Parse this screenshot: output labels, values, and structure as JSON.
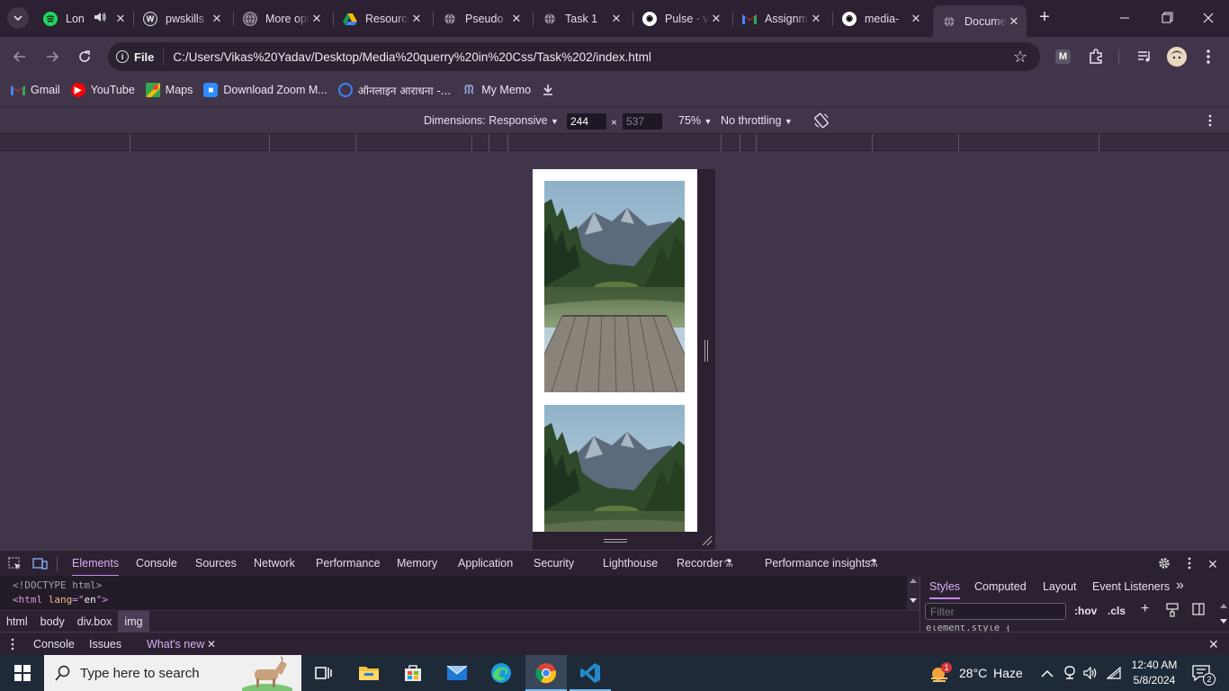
{
  "tabs": [
    {
      "label": "Lon",
      "icon": "spotify-icon",
      "audio": true
    },
    {
      "label": "pwskills",
      "icon": "wordpress-icon"
    },
    {
      "label": "More options",
      "icon": "globe-icon"
    },
    {
      "label": "Resources",
      "icon": "google-drive-icon"
    },
    {
      "label": "Pseudo",
      "icon": "globe-icon"
    },
    {
      "label": "Task 1",
      "icon": "globe-icon"
    },
    {
      "label": "Pulse · v",
      "icon": "github-icon"
    },
    {
      "label": "Assignment",
      "icon": "gmail-icon"
    },
    {
      "label": "media-",
      "icon": "github-icon"
    },
    {
      "label": "Document",
      "icon": "globe-icon",
      "active": true
    }
  ],
  "toolbar": {
    "file_chip": "File",
    "url": "C:/Users/Vikas%20Yadav/Desktop/Media%20querry%20in%20Css/Task%202/index.html"
  },
  "bookmarks": [
    {
      "label": "Gmail",
      "icon": "gmail-icon"
    },
    {
      "label": "YouTube",
      "icon": "youtube-icon"
    },
    {
      "label": "Maps",
      "icon": "maps-icon"
    },
    {
      "label": "Download Zoom M...",
      "icon": "zoom-icon"
    },
    {
      "label": "ऑनलाइन आराधना -...",
      "icon": "aradhana-icon"
    },
    {
      "label": "My Memo",
      "icon": "memo-icon"
    }
  ],
  "device": {
    "dimensions": "Dimensions: Responsive",
    "width": "244",
    "times": "×",
    "height": "537",
    "zoom": "75%",
    "throttle": "No throttling"
  },
  "devtools": {
    "tabs": [
      "Elements",
      "Console",
      "Sources",
      "Network",
      "Performance",
      "Memory",
      "Application",
      "Security",
      "Lighthouse",
      "Recorder",
      "Performance insights"
    ],
    "code_line1": "<!DOCTYPE html>",
    "code_line2_open": "<html ",
    "code_line2_attr": "lang",
    "code_line2_eq": "=\"",
    "code_line2_val": "en",
    "code_line2_close": "\">",
    "breadcrumbs": [
      "html",
      "body",
      "div.box",
      "img"
    ],
    "side_tabs": [
      "Styles",
      "Computed",
      "Layout",
      "Event Listeners"
    ],
    "filter_placeholder": "Filter",
    "hov": ":hov",
    "cls": ".cls",
    "element_style": "element.style {",
    "drawer_tabs": [
      "Console",
      "Issues",
      "What's new"
    ]
  },
  "taskbar": {
    "search_placeholder": "Type here to search",
    "weather_badge": "1",
    "temperature": "28°C",
    "weather": "Haze",
    "time": "12:40 AM",
    "date": "5/8/2024",
    "notif_count": "2"
  },
  "colors": {
    "frame": "#2c2133",
    "toolbar": "#41354a",
    "accent": "#c389f0"
  }
}
